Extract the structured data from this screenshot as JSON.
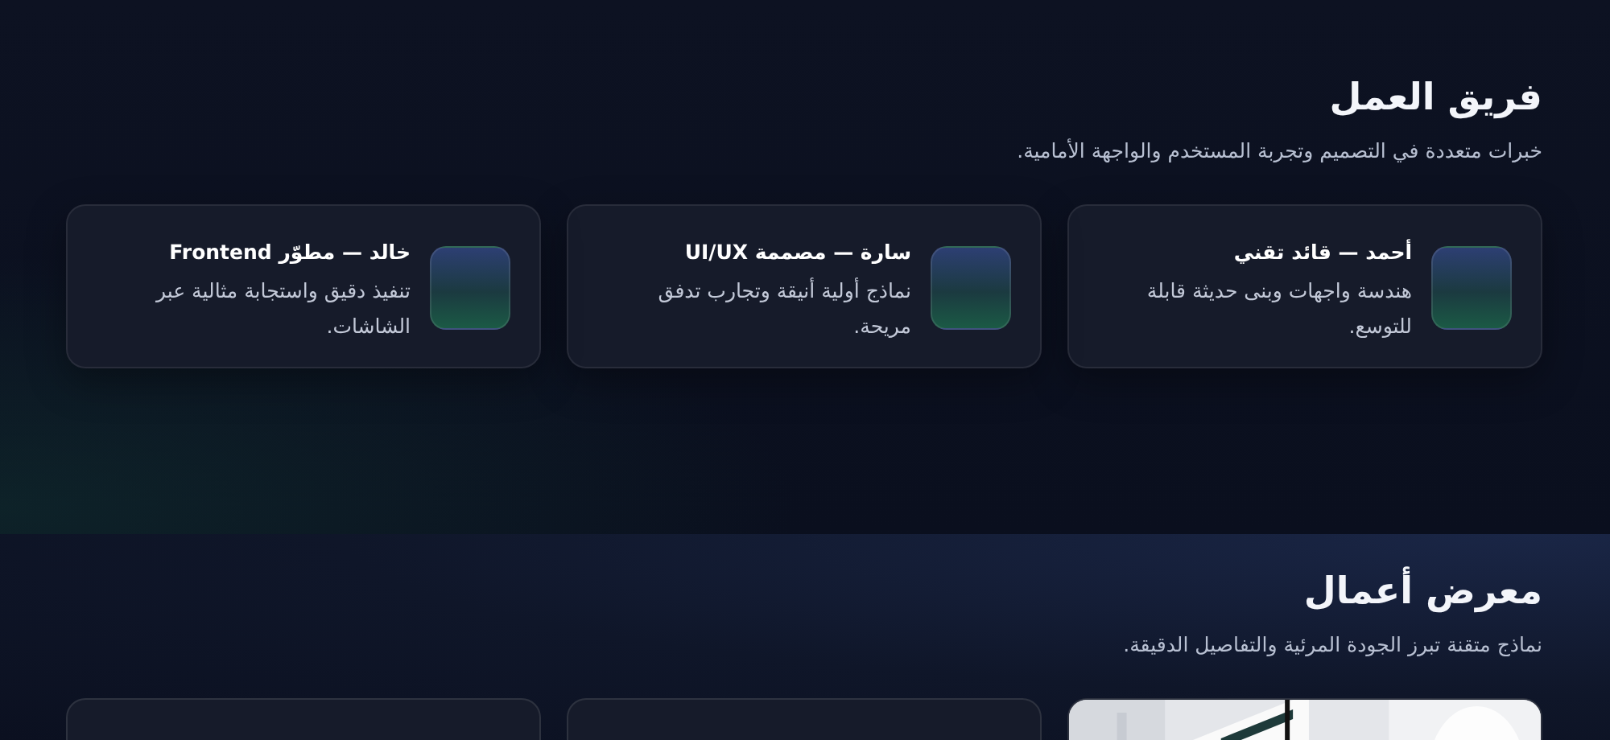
{
  "team": {
    "title": "فريق العمل",
    "subtitle": "خبرات متعددة في التصميم وتجربة المستخدم والواجهة الأمامية.",
    "members": [
      {
        "name": "أحمد — قائد تقني",
        "bio": "هندسة واجهات وبنى حديثة قابلة للتوسع."
      },
      {
        "name": "سارة — مصممة UI/UX",
        "bio": "نماذج أولية أنيقة وتجارب تدفق مريحة."
      },
      {
        "name": "خالد — مطوّر Frontend",
        "bio": "تنفيذ دقيق واستجابة مثالية عبر الشاشات."
      }
    ]
  },
  "gallery": {
    "title": "معرض أعمال",
    "subtitle": "نماذج متقنة تبرز الجودة المرئية والتفاصيل الدقيقة.",
    "items": [
      {
        "kind": "picture"
      },
      {
        "kind": "empty"
      },
      {
        "kind": "empty"
      }
    ]
  }
}
